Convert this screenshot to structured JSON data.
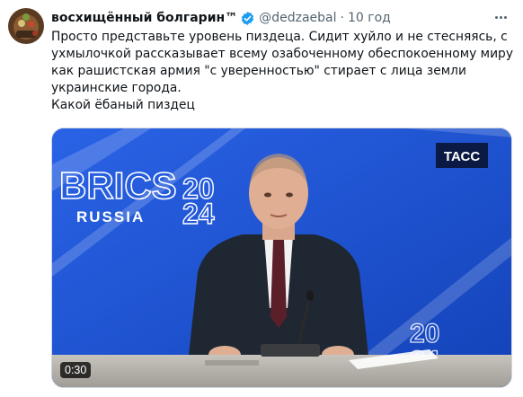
{
  "tweet": {
    "display_name": "восхищённый болгарин™",
    "handle": "@dedzaebal",
    "separator": "·",
    "time": "10 год",
    "text_lines": [
      "Просто представьте уровень пиздеца. Сидит хуйло и не стесняясь, с",
      "ухмылочкой рассказывает всему озабоченному обеспокоенному миру",
      "как рашистская армия \"с уверенностью\" стирает с лица земли",
      "украинские города.",
      "Какой ёбаный пиздец"
    ]
  },
  "video": {
    "duration": "0:30",
    "watermark": "ТАСС",
    "backdrop_brics": "BRICS",
    "backdrop_country": "RUSSIA",
    "backdrop_year_top": "20",
    "backdrop_year_bottom": "24"
  },
  "colors": {
    "backdrop_blue": "#1a4fd0",
    "accent_blue": "#1d9bf0",
    "secondary_text": "#536471"
  },
  "icons": [
    "avatar",
    "verified-badge-icon",
    "more-options-icon"
  ]
}
